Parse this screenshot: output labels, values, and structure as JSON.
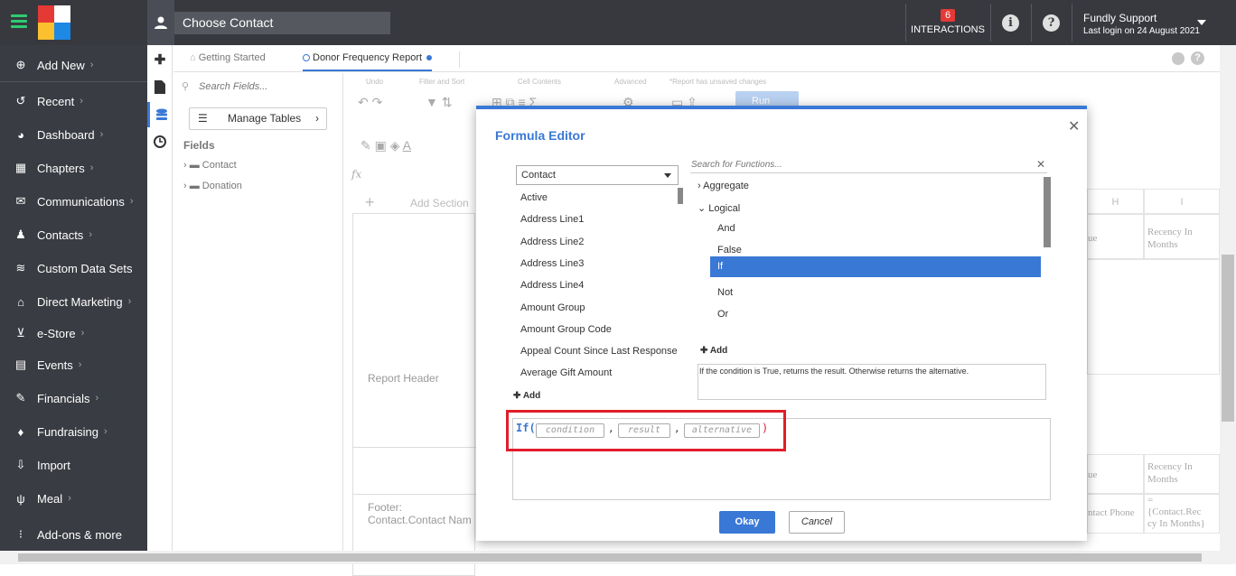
{
  "topbar": {
    "choose_contact": "Choose Contact",
    "interactions_count": "6",
    "interactions_label": "INTERACTIONS",
    "user_name": "Fundly Support",
    "last_login": "Last login on 24 August 2021"
  },
  "sidebar": {
    "items": [
      {
        "label": "Add New",
        "icon": "plus-circle-icon",
        "chevron": true
      },
      {
        "label": "Recent",
        "icon": "history-icon",
        "chevron": true
      },
      {
        "label": "Dashboard",
        "icon": "gauge-icon",
        "chevron": true
      },
      {
        "label": "Chapters",
        "icon": "grid-icon",
        "chevron": true
      },
      {
        "label": "Communications",
        "icon": "envelope-icon",
        "chevron": true
      },
      {
        "label": "Contacts",
        "icon": "person-icon",
        "chevron": true
      },
      {
        "label": "Custom Data Sets",
        "icon": "layers-icon",
        "chevron": false
      },
      {
        "label": "Direct Marketing",
        "icon": "building-icon",
        "chevron": true
      },
      {
        "label": "e-Store",
        "icon": "cart-icon",
        "chevron": true
      },
      {
        "label": "Events",
        "icon": "calendar-icon",
        "chevron": true
      },
      {
        "label": "Financials",
        "icon": "money-icon",
        "chevron": true
      },
      {
        "label": "Fundraising",
        "icon": "bag-icon",
        "chevron": true
      },
      {
        "label": "Import",
        "icon": "download-icon",
        "chevron": false
      },
      {
        "label": "Meal",
        "icon": "cutlery-icon",
        "chevron": true
      },
      {
        "label": "Add-ons & more",
        "icon": "apps-icon",
        "chevron": false
      }
    ]
  },
  "tabs": {
    "getting_started": "Getting Started",
    "report": "Donor Frequency Report"
  },
  "fields_panel": {
    "search_placeholder": "Search Fields...",
    "manage_tables": "Manage Tables",
    "title": "Fields",
    "tree": [
      "Contact",
      "Donation"
    ]
  },
  "toolbar": {
    "groups": [
      "Undo",
      "Filter and Sort",
      "Cell Contents",
      "Advanced",
      "*Report has unsaved changes"
    ],
    "run": "Run"
  },
  "grid": {
    "add_section": "Add Section",
    "report_header": "Report Header",
    "footer_line1": "Footer:",
    "footer_line2": "Contact.Contact Nam",
    "col_h": "H",
    "col_i": "I",
    "recency1": "Recency In Months",
    "recency2": "Recency In Months",
    "ue1": "ue",
    "ue2": "ue",
    "contact_phone": "ntact Phone",
    "formula_cell": "=\n{Contact.Rec\ncy In Months}"
  },
  "modal": {
    "title": "Formula Editor",
    "table_select": "Contact",
    "fields": [
      "Active",
      "Address Line1",
      "Address Line2",
      "Address Line3",
      "Address Line4",
      "Amount Group",
      "Amount Group Code",
      "Appeal Count Since Last Response",
      "Average Gift Amount"
    ],
    "add_field": "Add",
    "fn_search_placeholder": "Search for Functions...",
    "functions": [
      {
        "label": "Aggregate",
        "type": "group",
        "expanded": false
      },
      {
        "label": "Logical",
        "type": "group",
        "expanded": true
      },
      {
        "label": "And",
        "type": "fn"
      },
      {
        "label": "False",
        "type": "fn"
      },
      {
        "label": "If",
        "type": "fn",
        "selected": true
      },
      {
        "label": "Not",
        "type": "fn"
      },
      {
        "label": "Or",
        "type": "fn"
      }
    ],
    "add_function": "Add",
    "description": "If the condition is True, returns the result. Otherwise returns the alternative.",
    "formula": {
      "keyword": "If(",
      "args": [
        "condition",
        "result",
        "alternative"
      ],
      "close": ")"
    },
    "okay": "Okay",
    "cancel": "Cancel"
  }
}
